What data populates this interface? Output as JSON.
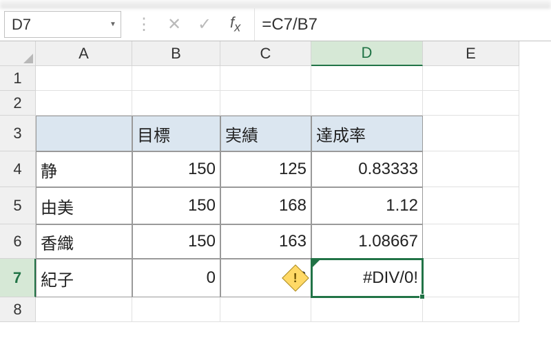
{
  "nameBox": "D7",
  "formula": "=C7/B7",
  "columns": [
    "A",
    "B",
    "C",
    "D",
    "E"
  ],
  "activeCol": "D",
  "activeRow": 7,
  "headers": {
    "B": "目標",
    "C": "実績",
    "D": "達成率"
  },
  "rows": [
    {
      "n": 4,
      "A": "静",
      "B": "150",
      "C": "125",
      "D": "0.83333"
    },
    {
      "n": 5,
      "A": "由美",
      "B": "150",
      "C": "168",
      "D": "1.12"
    },
    {
      "n": 6,
      "A": "香織",
      "B": "150",
      "C": "163",
      "D": "1.08667"
    },
    {
      "n": 7,
      "A": "紀子",
      "B": "0",
      "C": "56",
      "D": "#DIV/0!"
    }
  ],
  "errorIndicator": "!",
  "chart_data": {
    "type": "table",
    "title": "",
    "columns": [
      "",
      "目標",
      "実績",
      "達成率"
    ],
    "data": [
      [
        "静",
        150,
        125,
        0.83333
      ],
      [
        "由美",
        150,
        168,
        1.12
      ],
      [
        "香織",
        150,
        163,
        1.08667
      ],
      [
        "紀子",
        0,
        56,
        "#DIV/0!"
      ]
    ]
  }
}
